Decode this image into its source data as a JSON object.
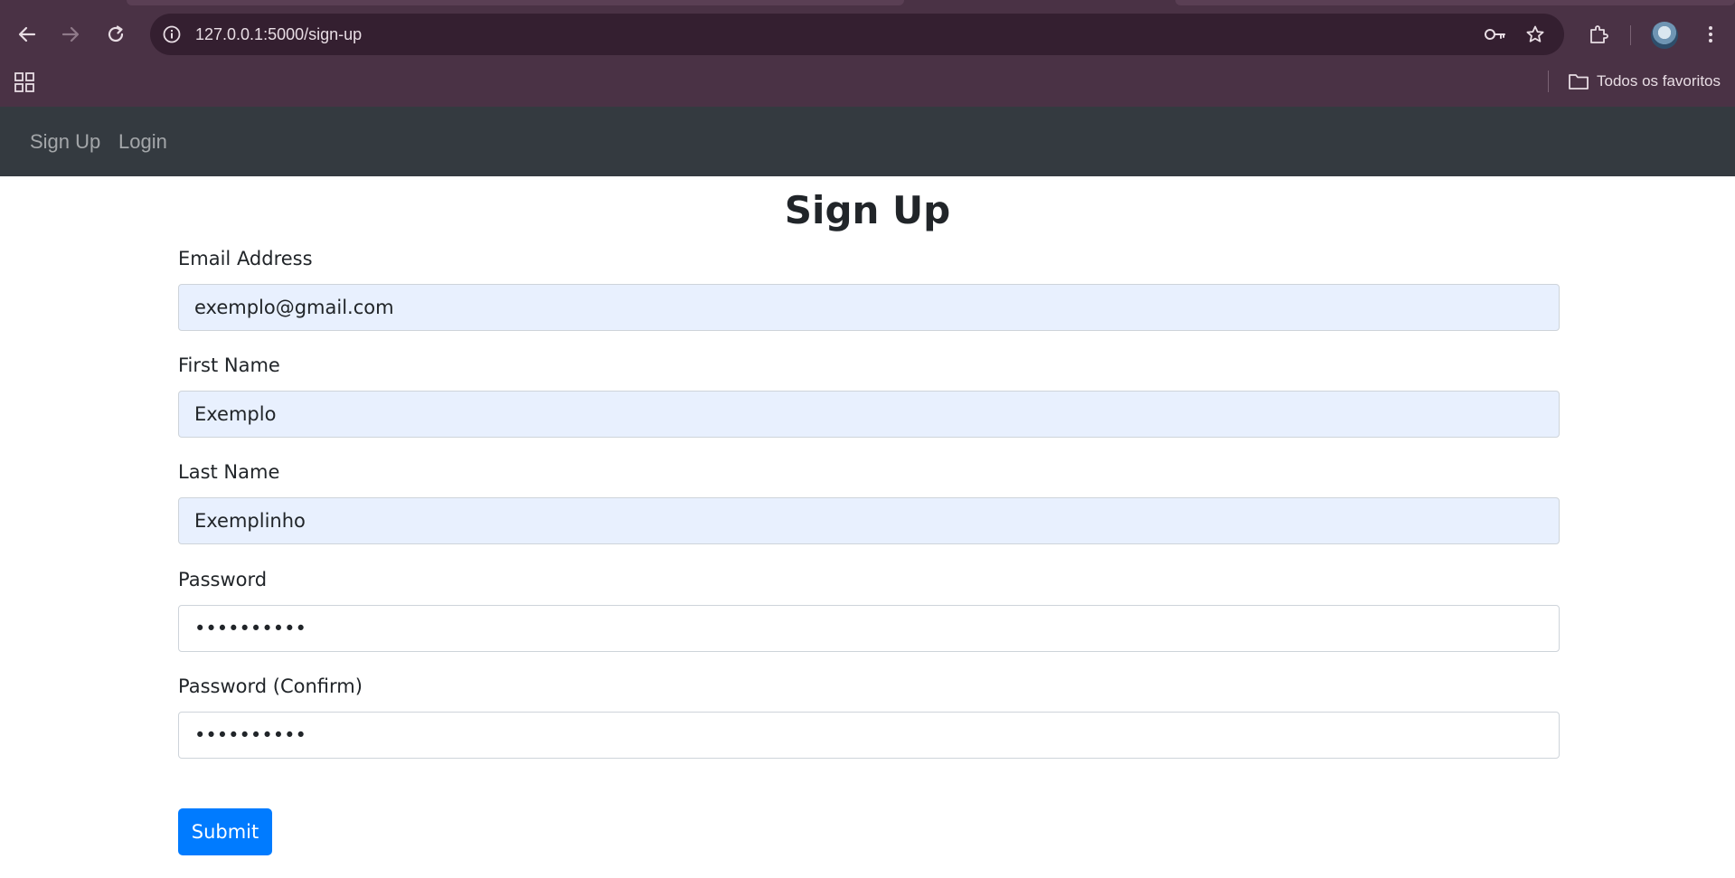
{
  "browser": {
    "url": "127.0.0.1:5000/sign-up",
    "bookmarks_folder_label": "Todos os favoritos",
    "icons": {
      "back": "arrow-left-icon",
      "forward": "arrow-right-icon",
      "reload": "reload-icon",
      "site_info": "info-icon",
      "password": "key-icon",
      "bookmark": "star-icon",
      "extensions": "puzzle-icon",
      "menu": "kebab-menu-icon",
      "apps": "apps-grid-icon",
      "folder": "folder-icon"
    },
    "colors": {
      "frame": "#4a3245",
      "omnibox": "#341f30"
    }
  },
  "navbar": {
    "links": [
      {
        "label": "Sign Up"
      },
      {
        "label": "Login"
      }
    ],
    "background": "#343a40"
  },
  "form": {
    "title": "Sign Up",
    "fields": [
      {
        "label": "Email Address",
        "type": "email",
        "value": "exemplo@gmail.com"
      },
      {
        "label": "First Name",
        "type": "text",
        "value": "Exemplo"
      },
      {
        "label": "Last Name",
        "type": "text",
        "value": "Exemplinho"
      },
      {
        "label": "Password",
        "type": "password",
        "value": "••••••••••"
      },
      {
        "label": "Password (Confirm)",
        "type": "password",
        "value": "••••••••••"
      }
    ],
    "submit_label": "Submit",
    "accent": "#007bff"
  }
}
